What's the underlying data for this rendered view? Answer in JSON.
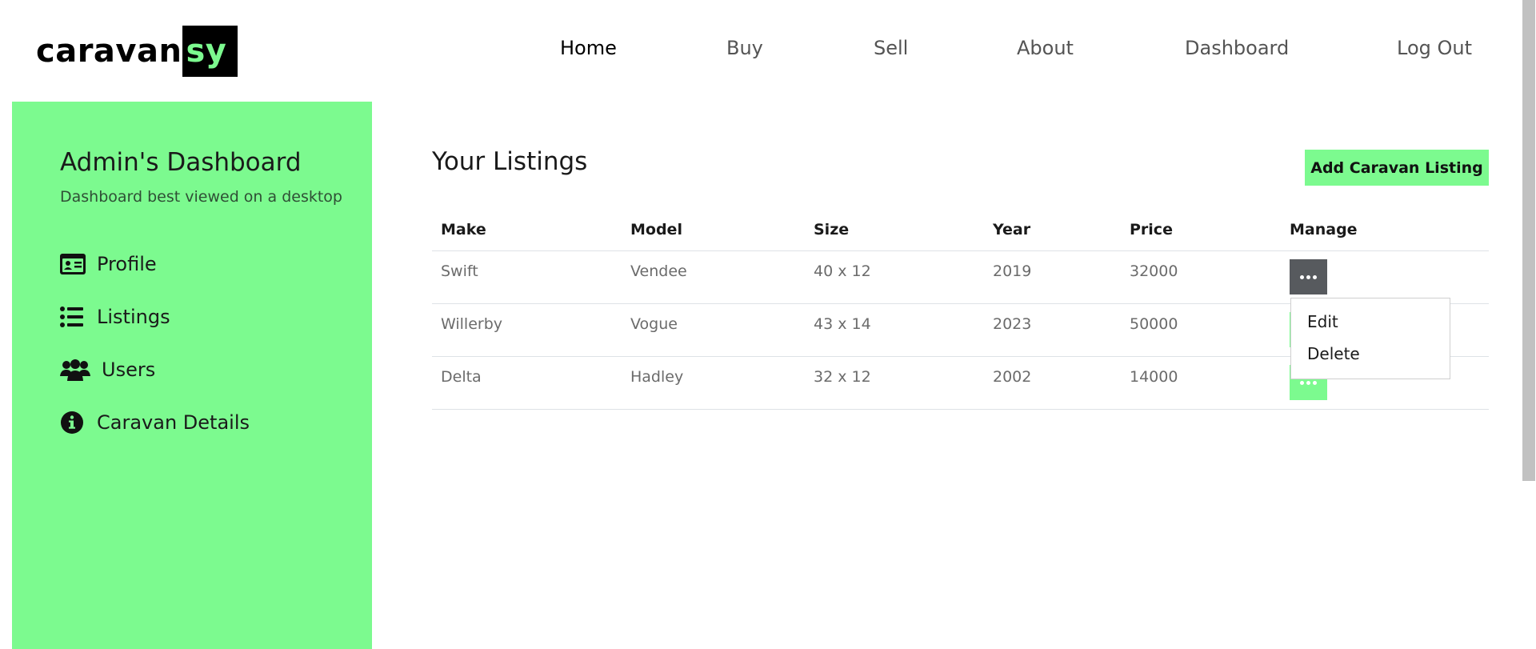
{
  "brand": {
    "name_main": "caravan",
    "name_accent": "sy",
    "accent_color": "#7cfa8f"
  },
  "nav": {
    "items": [
      {
        "label": "Home",
        "active": true
      },
      {
        "label": "Buy"
      },
      {
        "label": "Sell"
      },
      {
        "label": "About"
      },
      {
        "label": "Dashboard"
      },
      {
        "label": "Log Out"
      }
    ]
  },
  "sidebar": {
    "title": "Admin's Dashboard",
    "subtitle": "Dashboard best viewed on a desktop",
    "items": [
      {
        "label": "Profile",
        "icon": "id-card-icon"
      },
      {
        "label": "Listings",
        "icon": "list-icon"
      },
      {
        "label": "Users",
        "icon": "users-icon"
      },
      {
        "label": "Caravan Details",
        "icon": "info-circle-icon"
      }
    ]
  },
  "main": {
    "title": "Your Listings",
    "add_button": "Add Caravan Listing",
    "table": {
      "headers": [
        "Make",
        "Model",
        "Size",
        "Year",
        "Price",
        "Manage"
      ],
      "rows": [
        {
          "make": "Swift",
          "model": "Vendee",
          "size": "40 x 12",
          "year": "2019",
          "price": "32000"
        },
        {
          "make": "Willerby",
          "model": "Vogue",
          "size": "43 x 14",
          "year": "2023",
          "price": "50000"
        },
        {
          "make": "Delta",
          "model": "Hadley",
          "size": "32 x 12",
          "year": "2002",
          "price": "14000"
        }
      ]
    },
    "dropdown": {
      "items": [
        "Edit",
        "Delete"
      ]
    }
  },
  "colors": {
    "accent": "#7cfa8f",
    "manage_open": "#575a5e"
  }
}
